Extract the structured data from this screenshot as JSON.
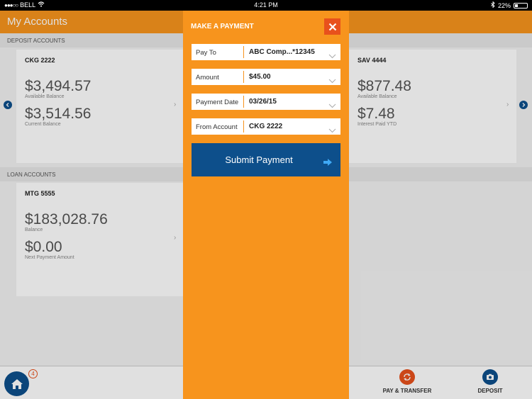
{
  "status_bar": {
    "carrier": "BELL",
    "time": "4:21 PM",
    "battery": "22%"
  },
  "header": {
    "title": "My Accounts"
  },
  "deposit_section": {
    "label": "DEPOSIT ACCOUNTS",
    "accounts": [
      {
        "name": "CKG 2222",
        "primary_amount": "$3,494.57",
        "primary_label": "Available Balance",
        "secondary_amount": "$3,514.56",
        "secondary_label": "Current Balance"
      },
      {
        "name": "SAV 4444",
        "primary_amount": "$877.48",
        "primary_label": "Available Balance",
        "secondary_amount": "$7.48",
        "secondary_label": "Interest Paid YTD"
      }
    ]
  },
  "loan_section": {
    "label": "LOAN ACCOUNTS",
    "accounts": [
      {
        "name": "MTG 5555",
        "primary_amount": "$183,028.76",
        "primary_label": "Balance",
        "secondary_amount": "$0.00",
        "secondary_label": "Next Payment Amount"
      }
    ]
  },
  "modal": {
    "title": "MAKE A PAYMENT",
    "fields": [
      {
        "label": "Pay To",
        "value": "ABC Comp...*12345"
      },
      {
        "label": "Amount",
        "value": "$45.00"
      },
      {
        "label": "Payment Date",
        "value": "03/26/15"
      },
      {
        "label": "From Account",
        "value": "CKG 2222"
      }
    ],
    "submit_label": "Submit Payment"
  },
  "bottom_bar": {
    "home_badge": "4",
    "tabs": [
      {
        "label": "PAY & TRANSFER",
        "icon": "refresh-icon"
      },
      {
        "label": "DEPOSIT",
        "icon": "camera-icon"
      }
    ]
  },
  "colors": {
    "brand_orange": "#f7941d",
    "close_red": "#e8511c",
    "navy": "#0d4f8b"
  }
}
